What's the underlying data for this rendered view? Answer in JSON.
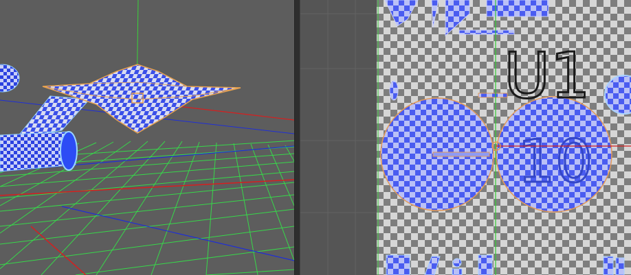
{
  "viewport": {
    "grid_colors": {
      "floor": "#37d94a",
      "axis_x": "#d81e1e",
      "axis_z": "#1e2ed8",
      "axis_y": "#3ad43a"
    },
    "selection_color": "#e8a24e",
    "mesh_color": "#3a4fe8"
  },
  "uv_editor": {
    "texture_label": "U1",
    "uv_island_label": "10",
    "checker_light": "#d8d8d8",
    "checker_dark": "#9a9a9a",
    "island_color": "#4a5cf0",
    "selection_color": "#e39a58",
    "axis_colors": {
      "v": "#34c834",
      "u": "#d21e1e"
    }
  }
}
